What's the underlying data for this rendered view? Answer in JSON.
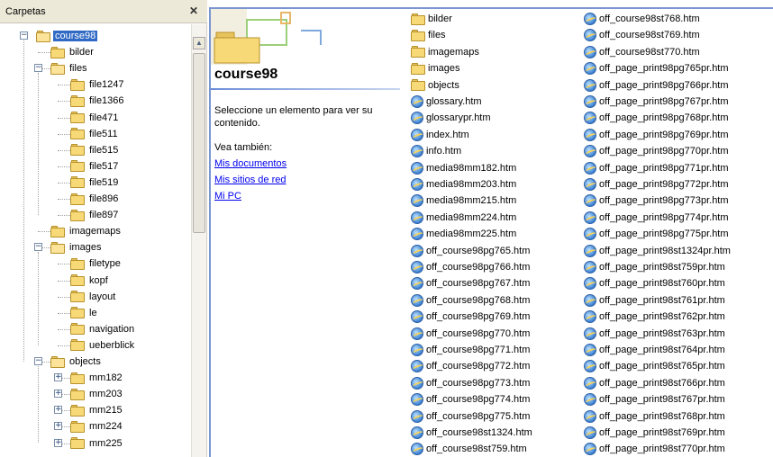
{
  "tree_pane": {
    "title": "Carpetas",
    "close_glyph": "✕"
  },
  "tree": [
    {
      "label": "course98",
      "level": 0,
      "toggle": "−",
      "selected": true,
      "open": true
    },
    {
      "label": "bilder",
      "level": 1,
      "toggle": "",
      "open": false
    },
    {
      "label": "files",
      "level": 1,
      "toggle": "−",
      "open": true
    },
    {
      "label": "file1247",
      "level": 2,
      "toggle": ""
    },
    {
      "label": "file1366",
      "level": 2,
      "toggle": ""
    },
    {
      "label": "file471",
      "level": 2,
      "toggle": ""
    },
    {
      "label": "file511",
      "level": 2,
      "toggle": ""
    },
    {
      "label": "file515",
      "level": 2,
      "toggle": ""
    },
    {
      "label": "file517",
      "level": 2,
      "toggle": ""
    },
    {
      "label": "file519",
      "level": 2,
      "toggle": ""
    },
    {
      "label": "file896",
      "level": 2,
      "toggle": ""
    },
    {
      "label": "file897",
      "level": 2,
      "toggle": ""
    },
    {
      "label": "imagemaps",
      "level": 1,
      "toggle": ""
    },
    {
      "label": "images",
      "level": 1,
      "toggle": "−",
      "open": true
    },
    {
      "label": "filetype",
      "level": 2,
      "toggle": ""
    },
    {
      "label": "kopf",
      "level": 2,
      "toggle": ""
    },
    {
      "label": "layout",
      "level": 2,
      "toggle": ""
    },
    {
      "label": "le",
      "level": 2,
      "toggle": ""
    },
    {
      "label": "navigation",
      "level": 2,
      "toggle": ""
    },
    {
      "label": "ueberblick",
      "level": 2,
      "toggle": ""
    },
    {
      "label": "objects",
      "level": 1,
      "toggle": "−",
      "open": true
    },
    {
      "label": "mm182",
      "level": 2,
      "toggle": "+"
    },
    {
      "label": "mm203",
      "level": 2,
      "toggle": "+"
    },
    {
      "label": "mm215",
      "level": 2,
      "toggle": "+"
    },
    {
      "label": "mm224",
      "level": 2,
      "toggle": "+"
    },
    {
      "label": "mm225",
      "level": 2,
      "toggle": "+"
    }
  ],
  "info_panel": {
    "folder_name": "course98",
    "description": "Seleccione un elemento para ver su contenido.",
    "see_also": "Vea también:",
    "links": [
      "Mis documentos",
      "Mis sitios de red",
      "Mi PC"
    ]
  },
  "files_col1": [
    {
      "name": "bilder",
      "type": "folder"
    },
    {
      "name": "files",
      "type": "folder"
    },
    {
      "name": "imagemaps",
      "type": "folder"
    },
    {
      "name": "images",
      "type": "folder"
    },
    {
      "name": "objects",
      "type": "folder"
    },
    {
      "name": "glossary.htm",
      "type": "htm"
    },
    {
      "name": "glossarypr.htm",
      "type": "htm"
    },
    {
      "name": "index.htm",
      "type": "htm"
    },
    {
      "name": "info.htm",
      "type": "htm"
    },
    {
      "name": "media98mm182.htm",
      "type": "htm"
    },
    {
      "name": "media98mm203.htm",
      "type": "htm"
    },
    {
      "name": "media98mm215.htm",
      "type": "htm"
    },
    {
      "name": "media98mm224.htm",
      "type": "htm"
    },
    {
      "name": "media98mm225.htm",
      "type": "htm"
    },
    {
      "name": "off_course98pg765.htm",
      "type": "htm"
    },
    {
      "name": "off_course98pg766.htm",
      "type": "htm"
    },
    {
      "name": "off_course98pg767.htm",
      "type": "htm"
    },
    {
      "name": "off_course98pg768.htm",
      "type": "htm"
    },
    {
      "name": "off_course98pg769.htm",
      "type": "htm"
    },
    {
      "name": "off_course98pg770.htm",
      "type": "htm"
    },
    {
      "name": "off_course98pg771.htm",
      "type": "htm"
    },
    {
      "name": "off_course98pg772.htm",
      "type": "htm"
    },
    {
      "name": "off_course98pg773.htm",
      "type": "htm"
    },
    {
      "name": "off_course98pg774.htm",
      "type": "htm"
    },
    {
      "name": "off_course98pg775.htm",
      "type": "htm"
    },
    {
      "name": "off_course98st1324.htm",
      "type": "htm"
    },
    {
      "name": "off_course98st759.htm",
      "type": "htm"
    }
  ],
  "files_col2": [
    {
      "name": "off_course98st768.htm",
      "type": "htm"
    },
    {
      "name": "off_course98st769.htm",
      "type": "htm"
    },
    {
      "name": "off_course98st770.htm",
      "type": "htm"
    },
    {
      "name": "off_page_print98pg765pr.htm",
      "type": "htm"
    },
    {
      "name": "off_page_print98pg766pr.htm",
      "type": "htm"
    },
    {
      "name": "off_page_print98pg767pr.htm",
      "type": "htm"
    },
    {
      "name": "off_page_print98pg768pr.htm",
      "type": "htm"
    },
    {
      "name": "off_page_print98pg769pr.htm",
      "type": "htm"
    },
    {
      "name": "off_page_print98pg770pr.htm",
      "type": "htm"
    },
    {
      "name": "off_page_print98pg771pr.htm",
      "type": "htm"
    },
    {
      "name": "off_page_print98pg772pr.htm",
      "type": "htm"
    },
    {
      "name": "off_page_print98pg773pr.htm",
      "type": "htm"
    },
    {
      "name": "off_page_print98pg774pr.htm",
      "type": "htm"
    },
    {
      "name": "off_page_print98pg775pr.htm",
      "type": "htm"
    },
    {
      "name": "off_page_print98st1324pr.htm",
      "type": "htm"
    },
    {
      "name": "off_page_print98st759pr.htm",
      "type": "htm"
    },
    {
      "name": "off_page_print98st760pr.htm",
      "type": "htm"
    },
    {
      "name": "off_page_print98st761pr.htm",
      "type": "htm"
    },
    {
      "name": "off_page_print98st762pr.htm",
      "type": "htm"
    },
    {
      "name": "off_page_print98st763pr.htm",
      "type": "htm"
    },
    {
      "name": "off_page_print98st764pr.htm",
      "type": "htm"
    },
    {
      "name": "off_page_print98st765pr.htm",
      "type": "htm"
    },
    {
      "name": "off_page_print98st766pr.htm",
      "type": "htm"
    },
    {
      "name": "off_page_print98st767pr.htm",
      "type": "htm"
    },
    {
      "name": "off_page_print98st768pr.htm",
      "type": "htm"
    },
    {
      "name": "off_page_print98st769pr.htm",
      "type": "htm"
    },
    {
      "name": "off_page_print98st770pr.htm",
      "type": "htm"
    }
  ],
  "colors": {
    "selection": "#316ac5",
    "link": "#0000ee",
    "folder": "#f7d978",
    "pane_border": "#7a96d1"
  }
}
